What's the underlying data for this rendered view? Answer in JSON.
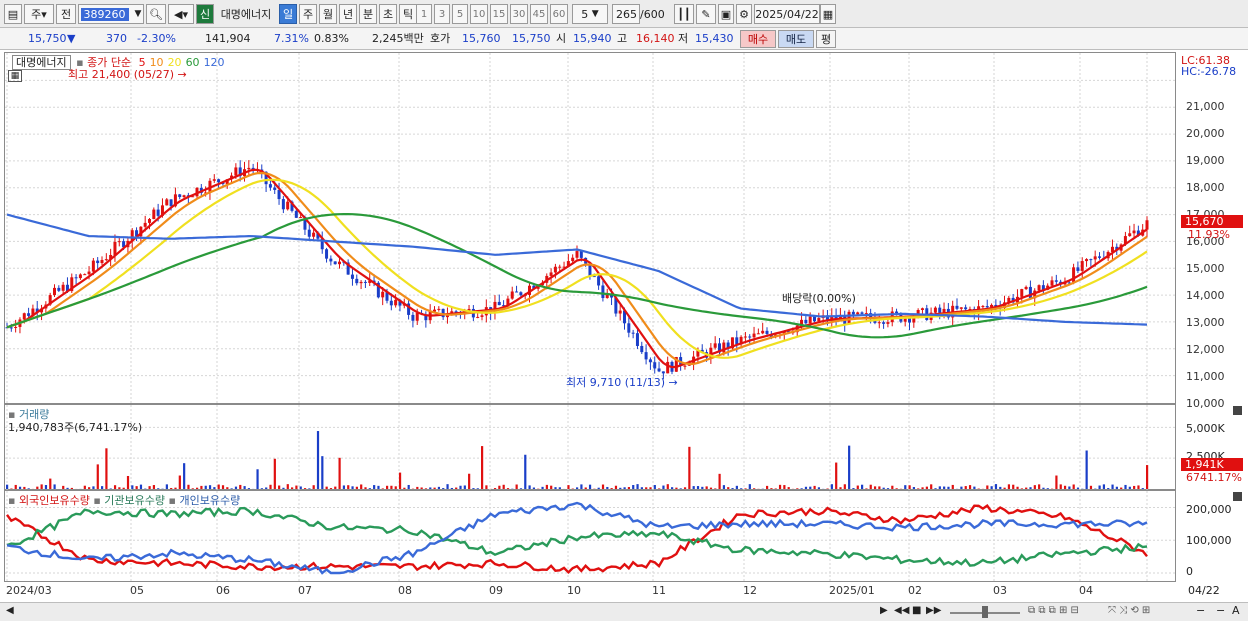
{
  "toolbar": {
    "type_label": "주",
    "jeon_label": "전",
    "code": "389260",
    "sin_label": "신",
    "name": "대명에너지",
    "periods": [
      "일",
      "주",
      "월",
      "년",
      "분",
      "초",
      "틱"
    ],
    "active_period": "일",
    "intervals": [
      "1",
      "3",
      "5",
      "10",
      "15",
      "30",
      "45",
      "60"
    ],
    "interval_value": "5",
    "count": "265",
    "count_max": "/600",
    "date": "2025/04/22"
  },
  "quote": {
    "price": "15,750",
    "change_arrow": "▼",
    "change": "370",
    "change_pct": "-2.30%",
    "volume": "141,904",
    "ratio1": "7.31%",
    "ratio2": "0.83%",
    "amount": "2,245백만",
    "hoga_label": "호가",
    "hoga1": "15,760",
    "hoga2": "15,750",
    "open_label": "시",
    "open": "15,940",
    "high_label": "고",
    "high": "16,140",
    "low_label": "저",
    "low": "15,430",
    "buy_label": "매수",
    "sell_label": "매도",
    "eval_label": "평"
  },
  "price_pane": {
    "title": "대명에너지",
    "legend_label": "종가 단순",
    "ma_periods": [
      "5",
      "10",
      "20",
      "60",
      "120"
    ],
    "ma_colors": [
      "#e01010",
      "#f08c1a",
      "#f0e020",
      "#2a9a3a",
      "#3a6ad8"
    ],
    "lc": "LC:61.38",
    "hc": "HC:-26.78",
    "y_ticks": [
      "21,000",
      "20,000",
      "19,000",
      "18,000",
      "17,000",
      "16,000",
      "15,000",
      "14,000",
      "13,000",
      "12,000",
      "11,000",
      "10,000"
    ],
    "current_price_tag": "15,670",
    "current_pct_tag": "11.93%",
    "annotations": {
      "high": "최고 21,400 (05/27)",
      "low": "최저 9,710 (11/13)",
      "ex_div": "배당락(0.00%)"
    }
  },
  "volume_pane": {
    "title": "거래량",
    "value": "1,940,783주(6,741.17%)",
    "y_ticks": [
      "5,000K",
      "2,500K"
    ],
    "last_tag": "1,941K",
    "last_pct": "6741.17%"
  },
  "holding_pane": {
    "legend": [
      "외국인보유수량",
      "기관보유수량",
      "개인보유수량"
    ],
    "colors": [
      "#e01010",
      "#2a9a5a",
      "#3a6ad8"
    ],
    "y_ticks": [
      "200,000",
      "100,000",
      "0"
    ]
  },
  "x_axis": {
    "labels": [
      "2024/03",
      "05",
      "06",
      "07",
      "08",
      "09",
      "10",
      "11",
      "12",
      "2025/01",
      "02",
      "03",
      "04"
    ],
    "right_label": "04/22"
  },
  "chart_data": {
    "type": "candlestick",
    "title": "대명에너지",
    "x": [
      "2024/03",
      "04",
      "05",
      "06",
      "07",
      "08",
      "09",
      "10",
      "11",
      "12",
      "2025/01",
      "02",
      "03",
      "04",
      "04/22"
    ],
    "close": [
      11800,
      13900,
      16500,
      17800,
      14300,
      12200,
      12500,
      14500,
      10200,
      11300,
      12100,
      12200,
      12500,
      13600,
      15670
    ],
    "ylim": [
      9500,
      21500
    ],
    "volume_ylim": [
      0,
      6000000
    ],
    "ma_120_trend": [
      16000,
      15200,
      15100,
      15200,
      15000,
      14800,
      14500,
      14700,
      13900,
      12500,
      12200,
      12300,
      12200,
      12000,
      11900
    ],
    "foreign_holding": [
      170000,
      40000,
      30000,
      20000,
      20000,
      20000,
      30000,
      10000,
      30000,
      180000,
      190000,
      160000,
      200000,
      170000,
      60000
    ],
    "institution_holding": [
      80000,
      190000,
      180000,
      190000,
      140000,
      130000,
      60000,
      110000,
      120000,
      70000,
      60000,
      40000,
      30000,
      60000,
      80000
    ],
    "individual_holding": [
      80000,
      40000,
      60000,
      40000,
      0,
      60000,
      180000,
      210000,
      140000,
      150000,
      150000,
      140000,
      150000,
      150000,
      150000
    ]
  }
}
